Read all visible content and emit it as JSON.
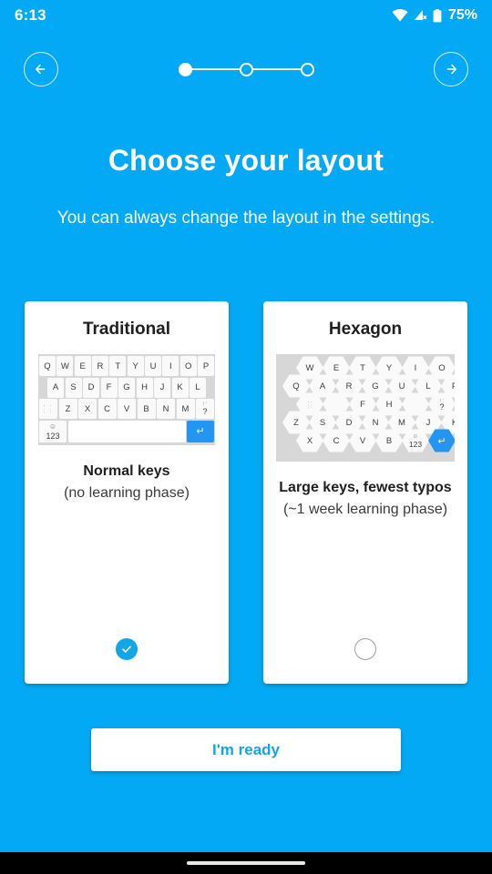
{
  "status_bar": {
    "time": "6:13",
    "battery_percent": "75%",
    "icons": [
      "wifi-icon",
      "cell-signal-off-icon",
      "battery-icon"
    ]
  },
  "top_nav": {
    "back_label": "back-arrow",
    "forward_label": "forward-arrow",
    "steps": {
      "total": 3,
      "current": 1
    }
  },
  "header": {
    "title": "Choose your layout",
    "subtitle": "You can always change the layout in the settings."
  },
  "options": [
    {
      "id": "traditional",
      "title": "Traditional",
      "desc_bold": "Normal keys",
      "desc_sub": "(no learning phase)",
      "selected": true,
      "keyboard": {
        "type": "qwerty",
        "rows": [
          [
            "Q",
            "W",
            "E",
            "R",
            "T",
            "Y",
            "U",
            "I",
            "O",
            "P"
          ],
          [
            "A",
            "S",
            "D",
            "F",
            "G",
            "H",
            "J",
            "K",
            "L"
          ],
          [
            ",.",
            ";:",
            "Z",
            "X",
            "C",
            "V",
            "B",
            "N",
            "M",
            "!?"
          ]
        ],
        "bottom": {
          "sym": "123",
          "emoji": "☺",
          "space": "",
          "enter": "↵"
        }
      }
    },
    {
      "id": "hexagon",
      "title": "Hexagon",
      "desc_bold": "Large keys, fewest typos",
      "desc_sub": "(~1 week learning phase)",
      "selected": false,
      "keyboard": {
        "type": "hexagon",
        "rows": [
          [
            "W",
            "E",
            "T",
            "Y",
            "I",
            "O"
          ],
          [
            "Q",
            "A",
            "R",
            "G",
            "U",
            "L",
            "P"
          ],
          [
            ",.;:",
            "",
            "F",
            "H",
            "",
            "!?"
          ],
          [
            "Z",
            "S",
            "D",
            "N",
            "M",
            "J",
            "K"
          ],
          [
            "X",
            "C",
            "V",
            "B",
            "123",
            "↵"
          ]
        ],
        "bottom": {
          "sym": "123",
          "emoji": "☺",
          "enter": "↵"
        }
      }
    }
  ],
  "footer": {
    "ready_label": "I'm ready"
  },
  "colors": {
    "background": "#03a9f4",
    "accent": "#12a6e8",
    "card": "#ffffff",
    "key_bg": "#fafafa",
    "keyboard_bg": "#d7d7d7"
  }
}
